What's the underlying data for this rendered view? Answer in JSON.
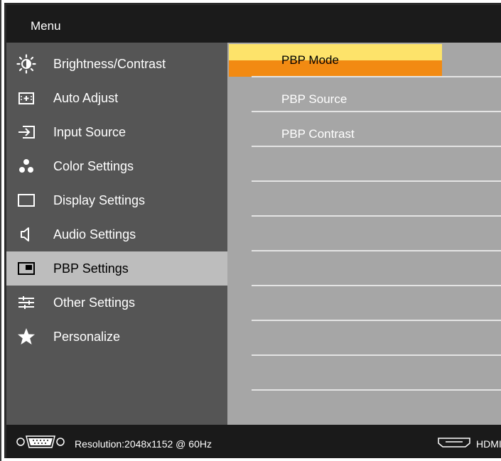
{
  "header": {
    "title": "Menu"
  },
  "sidebar": {
    "items": [
      {
        "label": "Brightness/Contrast",
        "icon": "brightness-icon"
      },
      {
        "label": "Auto Adjust",
        "icon": "auto-adjust-icon"
      },
      {
        "label": "Input Source",
        "icon": "input-source-icon"
      },
      {
        "label": "Color Settings",
        "icon": "color-settings-icon"
      },
      {
        "label": "Display Settings",
        "icon": "display-settings-icon"
      },
      {
        "label": "Audio Settings",
        "icon": "speaker-icon"
      },
      {
        "label": "PBP Settings",
        "icon": "pbp-icon",
        "selected": true
      },
      {
        "label": "Other Settings",
        "icon": "sliders-icon"
      },
      {
        "label": "Personalize",
        "icon": "star-icon"
      }
    ]
  },
  "submenu": {
    "items": [
      {
        "label": "PBP Mode",
        "selected": true
      },
      {
        "label": "PBP Source"
      },
      {
        "label": "PBP Contrast"
      }
    ]
  },
  "footer": {
    "resolution": "Resolution:2048x1152 @ 60Hz",
    "input": "HDMI",
    "icons": [
      "vga-connector-icon",
      "hdmi-connector-icon"
    ]
  },
  "colors": {
    "header_bg": "#1b1b1b",
    "sidebar_bg": "#555555",
    "sidebar_selected_bg": "#bdbdbd",
    "content_bg": "#a6a6a6",
    "highlight_top": "#fde36a",
    "highlight_bottom": "#f28a12"
  }
}
